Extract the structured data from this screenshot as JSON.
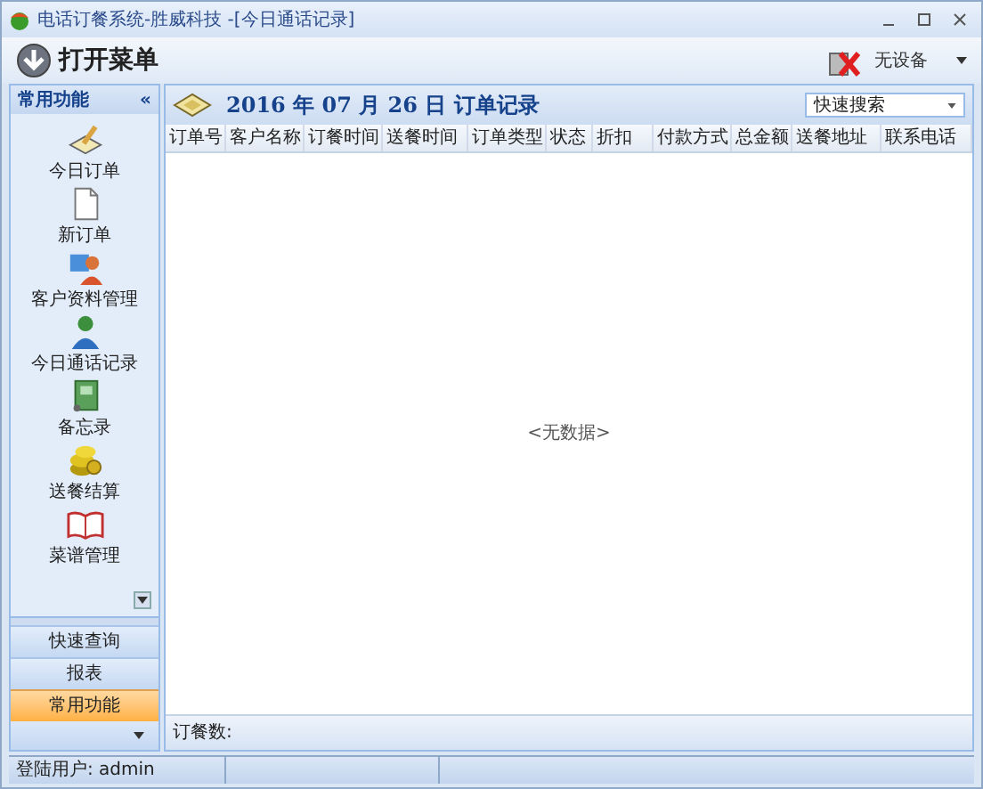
{
  "window": {
    "title": "电话订餐系统-胜威科技 -[今日通话记录]"
  },
  "toolbar": {
    "menu_button": "打开菜单",
    "device": "无设备"
  },
  "sidebar": {
    "title": "常用功能",
    "collapse": "«",
    "items": [
      {
        "label": "今日订单"
      },
      {
        "label": "新订单"
      },
      {
        "label": "客户资料管理"
      },
      {
        "label": "今日通话记录"
      },
      {
        "label": "备忘录"
      },
      {
        "label": "送餐结算"
      },
      {
        "label": "菜谱管理"
      }
    ],
    "groups": [
      {
        "label": "快速查询",
        "selected": false
      },
      {
        "label": "报表",
        "selected": false
      },
      {
        "label": "常用功能",
        "selected": true
      }
    ]
  },
  "orders": {
    "title": "2016 年 07 月 26 日 订单记录",
    "search": {
      "value": "快速搜索"
    },
    "columns": [
      "订单号",
      "客户名称",
      "订餐时间",
      "送餐时间",
      "订单类型",
      "状态",
      "折扣",
      "付款方式",
      "总金额",
      "送餐地址",
      "联系电话"
    ],
    "empty_text": "<无数据>",
    "footer": "订餐数:"
  },
  "status_bar": {
    "user": "登陆用户: admin"
  }
}
